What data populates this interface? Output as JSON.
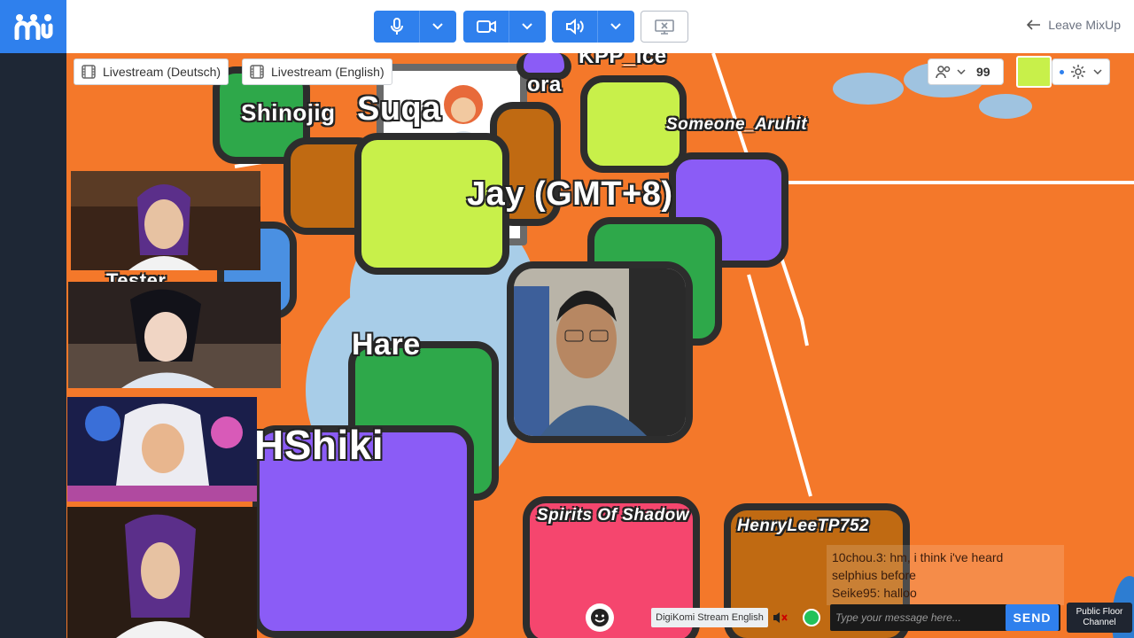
{
  "topbar": {
    "leave_label": "Leave MixUp"
  },
  "world": {
    "stream_tags": [
      "Livestream (Deutsch)",
      "Livestream (English)"
    ],
    "people_count": "99",
    "names": {
      "suqa": "Suqa",
      "shinojig": "Shinojig",
      "jay": "Jay (GMT+8)",
      "hare": "Hare",
      "hshiki": "HShiki",
      "kpp_ice": "KPP_Ice",
      "ora": "ora",
      "someone_aruhit": "Someone_Aruhit",
      "tester": "Tester",
      "spirits": "Spirits Of Shadow",
      "henrylee": "HenryLeeTP752"
    }
  },
  "chat": {
    "messages": [
      "10chou.3: hm, i think i've heard",
      "selphius before",
      "Seike95: halloo"
    ],
    "input_placeholder": "Type your message here...",
    "send_label": "SEND",
    "channel_label": "Public Floor Channel",
    "stream_label": "DigiKomi Stream English"
  },
  "colors": {
    "accent": "#2f80ed",
    "floor": "#f4782a",
    "lime": "#c8f04a",
    "purple": "#8b5cf6",
    "green": "#2ea84a"
  }
}
